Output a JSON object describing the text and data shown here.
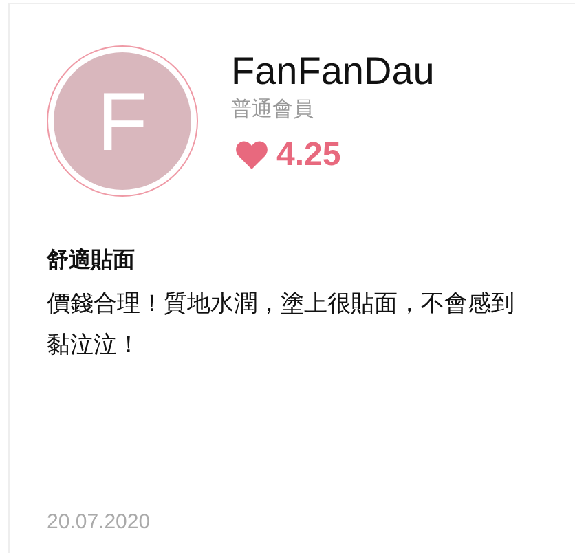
{
  "reviewer": {
    "avatar_letter": "F",
    "name": "FanFanDau",
    "membership": "普通會員",
    "rating": "4.25"
  },
  "review": {
    "title": "舒適貼面",
    "body": "價錢合理！質地水潤，塗上很貼面，不會感到黏泣泣！",
    "date": "20.07.2020"
  }
}
